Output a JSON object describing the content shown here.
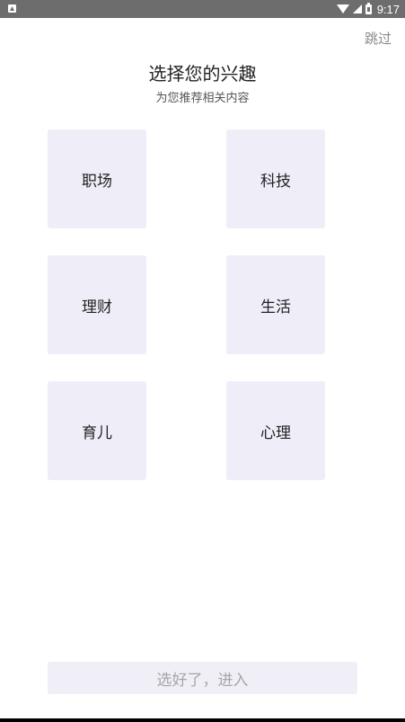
{
  "status_bar": {
    "time": "9:17",
    "left_icon": "notification-icon",
    "icons": [
      "wifi-icon",
      "signal-icon",
      "battery-icon"
    ]
  },
  "header": {
    "skip_label": "跳过",
    "title": "选择您的兴趣",
    "subtitle": "为您推荐相关内容"
  },
  "interests": [
    {
      "label": "职场"
    },
    {
      "label": "科技"
    },
    {
      "label": "理财"
    },
    {
      "label": "生活"
    },
    {
      "label": "育儿"
    },
    {
      "label": "心理"
    }
  ],
  "footer": {
    "submit_label": "选好了，进入"
  },
  "colors": {
    "status_bar": "#6d6d6d",
    "tile_background": "#efeef8",
    "button_background": "#f0eff8",
    "button_text": "#a6a6a6",
    "skip_text": "#8a8a8a"
  }
}
